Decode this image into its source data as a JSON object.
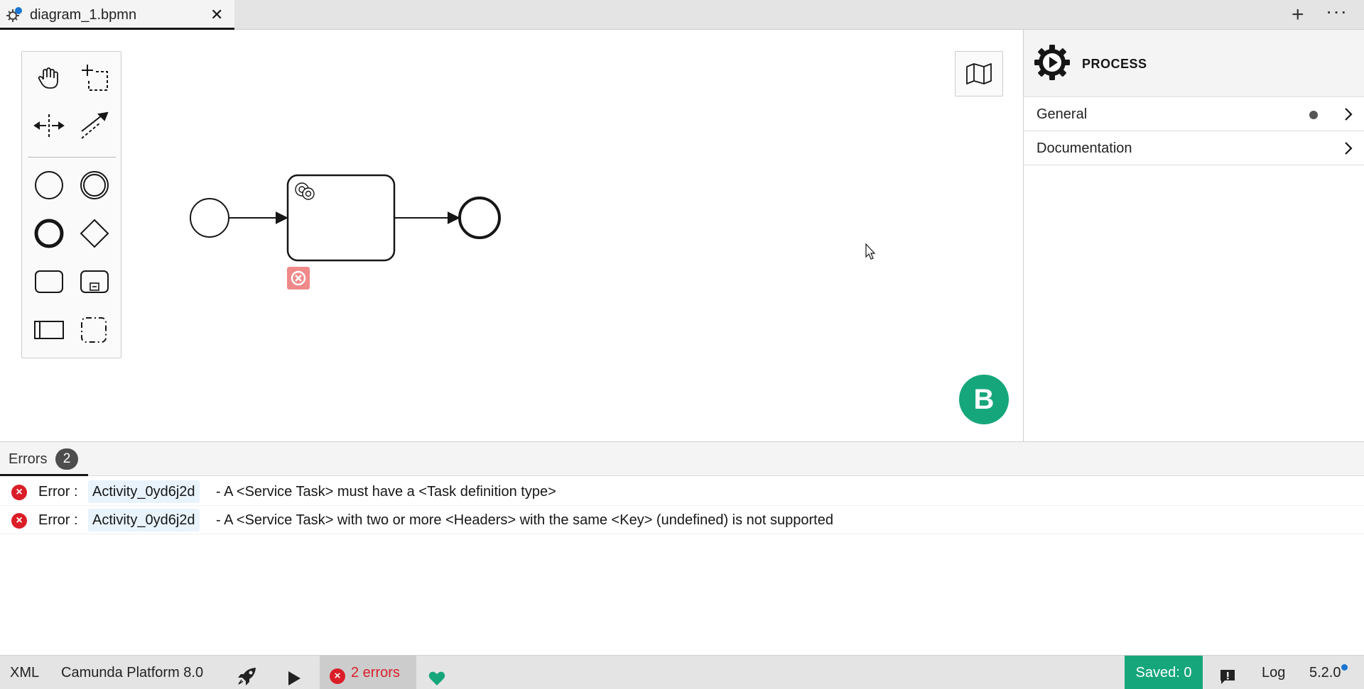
{
  "tab": {
    "title": "diagram_1.bpmn",
    "close_glyph": "✕"
  },
  "tabbar": {
    "add_glyph": "+",
    "more_glyph": "···"
  },
  "properties": {
    "title": "PROCESS",
    "groups": [
      {
        "label": "General",
        "has_indicator": true
      },
      {
        "label": "Documentation",
        "has_indicator": false
      }
    ]
  },
  "canvas": {
    "logo_letter": "B",
    "palette_tools": [
      "hand-tool-icon",
      "lasso-tool-icon",
      "space-tool-icon",
      "global-connect-icon",
      "start-event-icon",
      "intermediate-event-icon",
      "end-event-icon",
      "gateway-icon",
      "task-icon",
      "subprocess-icon",
      "pool-icon",
      "group-icon"
    ]
  },
  "errors_panel": {
    "tab_label": "Errors",
    "count": "2",
    "items": [
      {
        "label": "Error :",
        "element_id": "Activity_0yd6j2d",
        "message": "- A <Service Task> must have a <Task definition type>"
      },
      {
        "label": "Error :",
        "element_id": "Activity_0yd6j2d",
        "message": "- A <Service Task> with two or more <Headers> with the same <Key> (undefined) is not supported"
      }
    ]
  },
  "statusbar": {
    "xml": "XML",
    "platform": "Camunda Platform 8.0",
    "errors": "2 errors",
    "saved": "Saved: 0",
    "log": "Log",
    "version": "5.2.0"
  },
  "colors": {
    "brand_green": "#16a67c",
    "error_red": "#da1e28",
    "accent_blue": "#1a76d2"
  }
}
